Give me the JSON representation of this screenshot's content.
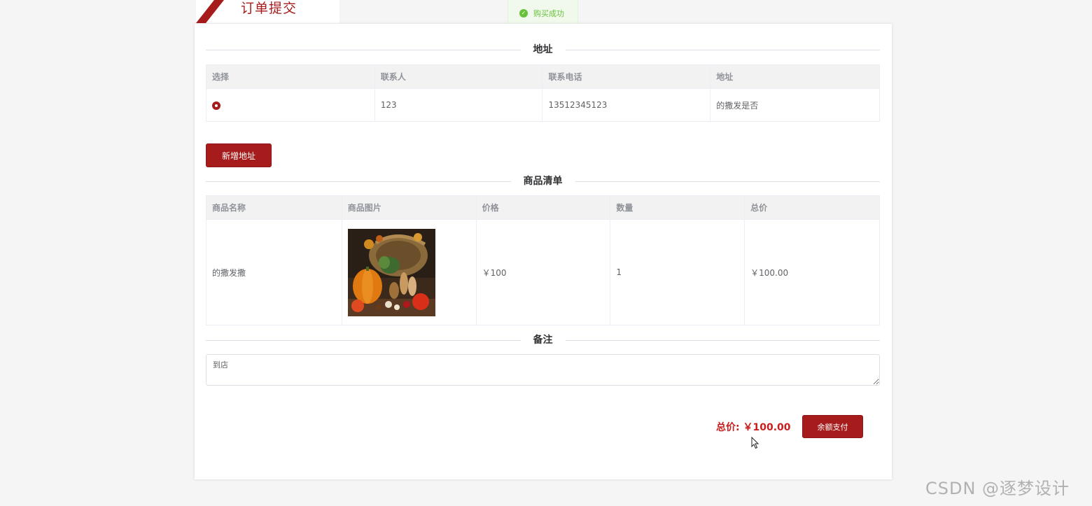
{
  "header": {
    "title": "订单提交"
  },
  "toast": {
    "icon": "check-circle-icon",
    "message": "购买成功",
    "color": "#67c23a"
  },
  "address_section": {
    "title": "地址",
    "columns": [
      "选择",
      "联系人",
      "联系电话",
      "地址"
    ],
    "rows": [
      {
        "selected": true,
        "contact": "123",
        "phone": "13512345123",
        "address": "的撒发是否"
      }
    ],
    "add_button_label": "新增地址"
  },
  "goods_section": {
    "title": "商品清单",
    "columns": [
      "商品名称",
      "商品图片",
      "价格",
      "数量",
      "总价"
    ],
    "rows": [
      {
        "name": "的撒发撒",
        "image": "vegetable-basket-image",
        "price": "￥100",
        "quantity": "1",
        "subtotal": "￥100.00"
      }
    ]
  },
  "remark_section": {
    "title": "备注",
    "value": "到店"
  },
  "footer": {
    "total_label": "总价:",
    "total_value": "￥100.00",
    "pay_button_label": "余额支付"
  },
  "watermark": "CSDN @逐梦设计",
  "colors": {
    "brand": "#a61b1b",
    "price": "#c81d1d"
  }
}
